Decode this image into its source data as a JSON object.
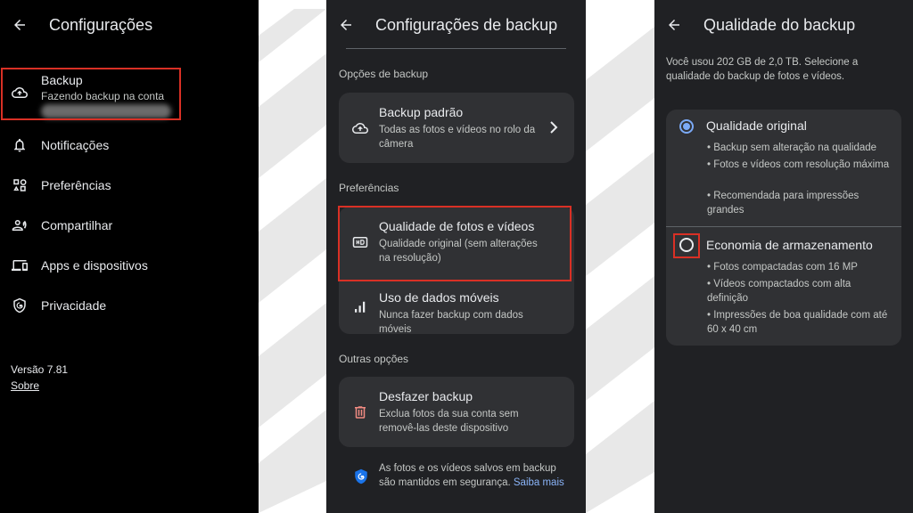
{
  "panel1": {
    "title": "Configurações",
    "backup": {
      "label": "Backup",
      "status": "Fazendo backup na conta"
    },
    "items": [
      {
        "label": "Notificações"
      },
      {
        "label": "Preferências"
      },
      {
        "label": "Compartilhar"
      },
      {
        "label": "Apps e dispositivos"
      },
      {
        "label": "Privacidade"
      }
    ],
    "version": "Versão 7.81",
    "about": "Sobre"
  },
  "panel2": {
    "title": "Configurações de backup",
    "section1": "Opções de backup",
    "backup_default": {
      "title": "Backup padrão",
      "subtitle": "Todas as fotos e vídeos no rolo da câmera"
    },
    "section2": "Preferências",
    "quality": {
      "title": "Qualidade de fotos e vídeos",
      "subtitle": "Qualidade original (sem alterações na resolução)"
    },
    "mobile_data": {
      "title": "Uso de dados móveis",
      "subtitle": "Nunca fazer backup com dados móveis"
    },
    "section3": "Outras opções",
    "undo": {
      "title": "Desfazer backup",
      "subtitle": "Exclua fotos da sua conta sem removê-las deste dispositivo"
    },
    "footer_text": "As fotos e os vídeos salvos em backup são mantidos em segurança.",
    "footer_link": "Saiba mais"
  },
  "panel3": {
    "title": "Qualidade do backup",
    "intro": "Você usou 202 GB de 2,0 TB. Selecione a qualidade do backup de fotos e vídeos.",
    "original": {
      "label": "Qualidade original",
      "selected": true,
      "bullets": [
        "Backup sem alteração na qualidade",
        "Fotos e vídeos com resolução máxima",
        "Recomendada para impressões grandes"
      ]
    },
    "economy": {
      "label": "Economia de armazenamento",
      "selected": false,
      "bullets": [
        "Fotos compactadas com 16 MP",
        "Vídeos compactados com alta definição",
        "Impressões de boa qualidade com até 60 x 40 cm"
      ]
    }
  },
  "colors": {
    "highlight": "#d93025",
    "accent": "#8ab4f8",
    "radio_selected": "#7baaf7",
    "card": "#303134",
    "panel": "#202124"
  }
}
